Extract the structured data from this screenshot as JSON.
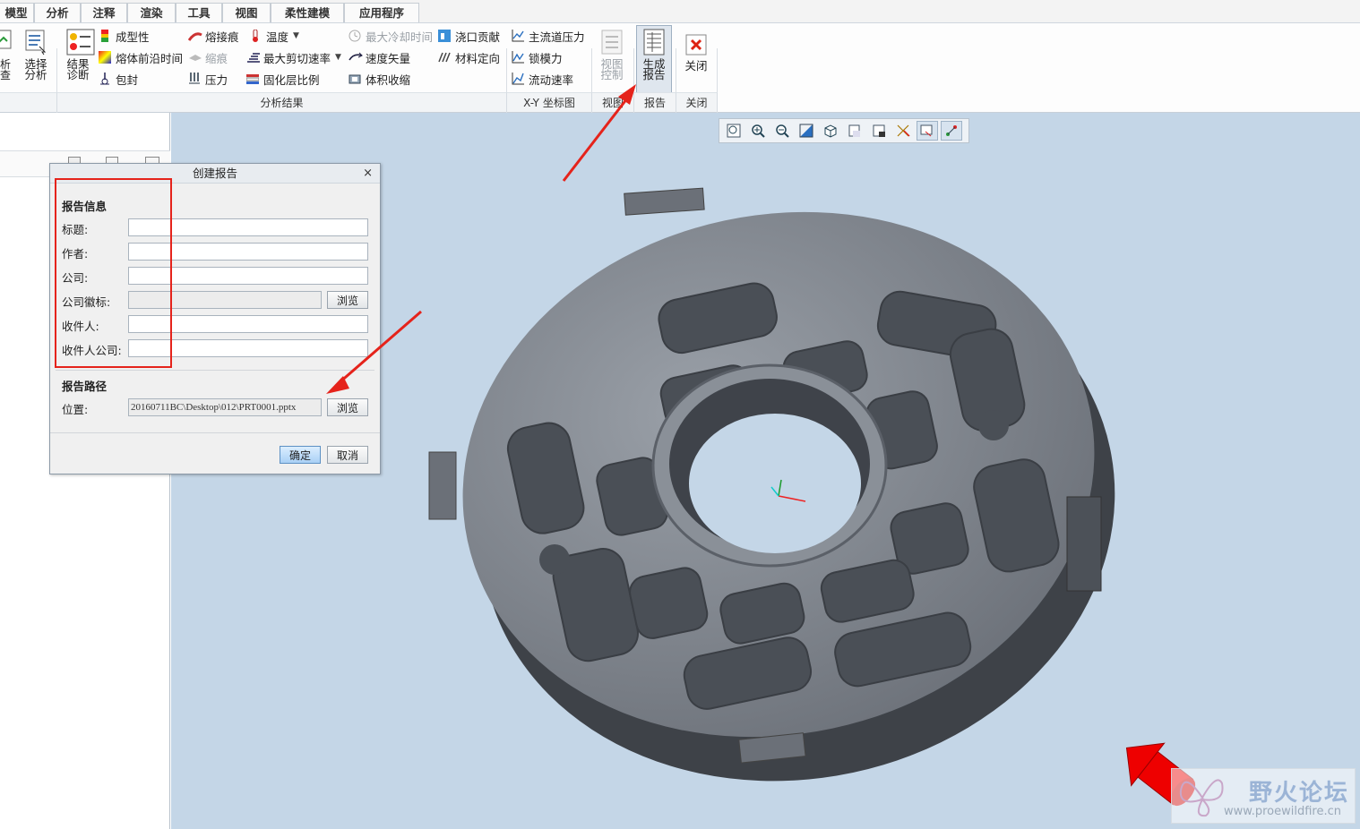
{
  "tabs": [
    "模型",
    "分析",
    "注释",
    "渲染",
    "工具",
    "视图",
    "柔性建模",
    "应用程序"
  ],
  "left_big": {
    "a": "析\n查",
    "b": "选择\n分析"
  },
  "results_big": "结果\n诊断",
  "col1": [
    "成型性",
    "熔体前沿时间",
    "包封"
  ],
  "col2": [
    "熔接痕",
    "缩痕",
    "压力"
  ],
  "col3": [
    "温度",
    "最大剪切速率",
    "固化层比例"
  ],
  "col4": [
    "最大冷却时间",
    "速度矢量",
    "体积收缩"
  ],
  "col5": [
    "浇口贡献",
    "材料定向"
  ],
  "col6": [
    "主流道压力",
    "锁模力",
    "流动速率"
  ],
  "view_ctrl": "视图\n控制",
  "gen_report": "生成\n报告",
  "close_btn": "关闭",
  "groups": {
    "results": "分析结果",
    "xy": "X-Y 坐标图",
    "view": "视图",
    "report": "报告",
    "close": "关闭"
  },
  "dialog": {
    "title": "创建报告",
    "close": "×",
    "info_heading": "报告信息",
    "fields": {
      "title": "标题:",
      "author": "作者:",
      "company": "公司:",
      "logo": "公司徽标:",
      "recipient": "收件人:",
      "recipient_company": "收件人公司:"
    },
    "browse": "浏览",
    "path_heading": "报告路径",
    "location_label": "位置:",
    "location_value": "20160711BC\\Desktop\\012\\PRT0001.pptx",
    "ok": "确定",
    "cancel": "取消"
  },
  "watermark": {
    "title": "野火论坛",
    "url": "www.proewildfire.cn"
  },
  "colors": {
    "annotation_red": "#e5231b",
    "viewport_bg": "#c4d6e7",
    "part_gray": "#7f848c"
  }
}
